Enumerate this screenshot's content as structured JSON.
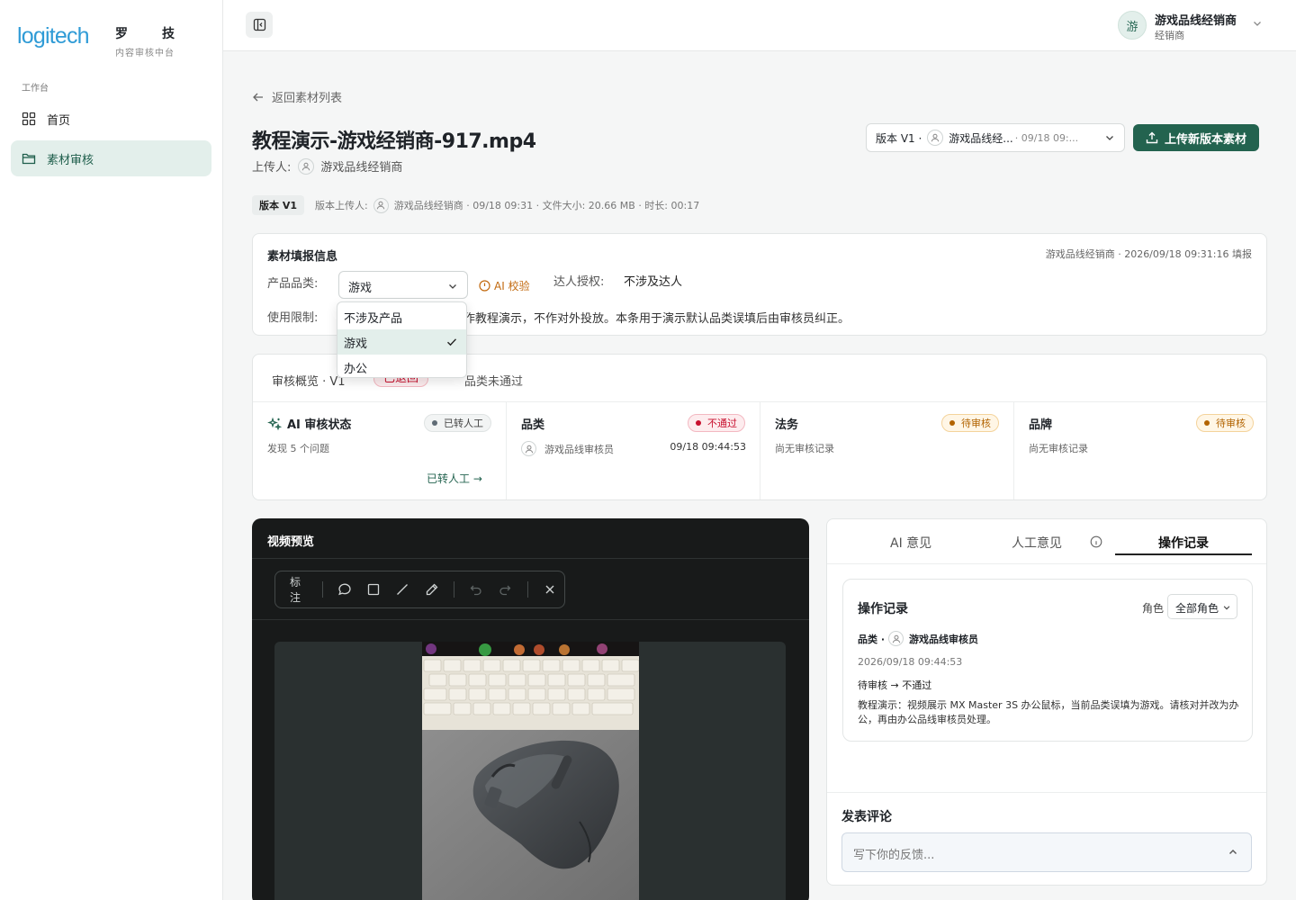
{
  "sidebar": {
    "logo": "logitech",
    "brand_cn_1": "罗",
    "brand_cn_2": "技",
    "brand_sub": "内容审核中台",
    "section": "工作台",
    "items": [
      {
        "label": "首页",
        "icon": "grid-icon"
      },
      {
        "label": "素材审核",
        "icon": "folder-icon",
        "active": true
      }
    ]
  },
  "header": {
    "avatar_initial": "游",
    "user_name": "游戏品线经销商",
    "user_role": "经销商"
  },
  "page": {
    "back_label": "返回素材列表",
    "title": "教程演示-游戏经销商-917.mp4",
    "uploader_label": "上传人:",
    "uploader_name": "游戏品线经销商",
    "version_select": {
      "version": "版本 V1 ·",
      "user": "游戏品线经...",
      "date": "· 09/18 09:..."
    },
    "upload_button": "上传新版本素材",
    "meta": {
      "badge": "版本 V1",
      "uploader_label": "版本上传人:",
      "text": "游戏品线经销商 · 09/18 09:31 · 文件大小: 20.66 MB · 时长: 00:17"
    }
  },
  "info": {
    "title": "素材填报信息",
    "filled_by": "游戏品线经销商 · 2026/09/18 09:31:16 填报",
    "category_label": "产品品类:",
    "category_value": "游戏",
    "ai_check": "AI 校验",
    "talent_label": "达人授权:",
    "talent_value": "不涉及达人",
    "usage_label": "使用限制:",
    "usage_value": "作教程演示，不作对外投放。本条用于演示默认品类误填后由审核员纠正。",
    "dropdown_options": [
      "不涉及产品",
      "游戏",
      "办公"
    ],
    "dropdown_selected": "游戏"
  },
  "review": {
    "title": "审核概览 · V1",
    "badge": "已退回",
    "reason": "品类未通过",
    "columns": [
      {
        "title": "AI 审核状态",
        "status": "已转人工",
        "sub": "发现 5 个问题",
        "link": "已转人工 →"
      },
      {
        "title": "品类",
        "status": "不通过",
        "sub": "游戏品线审核员",
        "time": "09/18 09:44:53"
      },
      {
        "title": "法务",
        "status": "待审核",
        "sub": "尚无审核记录"
      },
      {
        "title": "品牌",
        "status": "待审核",
        "sub": "尚无审核记录"
      }
    ]
  },
  "video": {
    "title": "视频预览",
    "toolbar_label": "标注",
    "tools": [
      "comment-icon",
      "rectangle-icon",
      "line-icon",
      "pencil-icon",
      "undo-icon",
      "redo-icon",
      "close-icon"
    ]
  },
  "panel": {
    "tabs": [
      "AI 意见",
      "人工意见",
      "操作记录"
    ],
    "active_tab": "操作记录",
    "log": {
      "title": "操作记录",
      "role_label": "角色",
      "role_value": "全部角色",
      "category": "品类 ·",
      "reviewer": "游戏品线审核员",
      "time": "2026/09/18 09:44:53",
      "status": "待审核 → 不通过",
      "desc": "教程演示：视频展示 MX Master 3S 办公鼠标，当前品类误填为游戏。请核对并改为办公，再由办公品线审核员处理。"
    },
    "comment_title": "发表评论",
    "comment_placeholder": "写下你的反馈..."
  },
  "colors": {
    "accent": "#23634f",
    "danger": "#c8102e",
    "warning": "#b26300",
    "logo": "#2f9bd6"
  }
}
